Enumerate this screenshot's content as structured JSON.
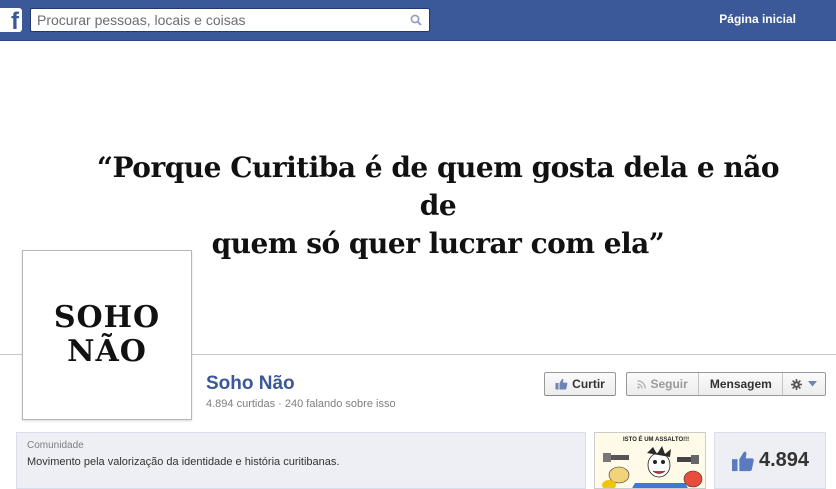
{
  "topbar": {
    "logo_letter": "f",
    "search_placeholder": "Procurar pessoas, locais e coisas",
    "home_label": "Página inicial"
  },
  "cover": {
    "quote_line1": "“Porque Curitiba é de quem gosta dela e não de",
    "quote_line2": "quem só quer lucrar com ela”"
  },
  "profile": {
    "pic_line1": "SOHO",
    "pic_line2": "NÃO",
    "name": "Soho Não",
    "stats": "4.894 curtidas · 240 falando sobre isso"
  },
  "actions": {
    "like_label": "Curtir",
    "follow_label": "Seguir",
    "message_label": "Mensagem"
  },
  "about": {
    "category": "Comunidade",
    "description": "Movimento pela valorização da identidade e história curitibanas."
  },
  "photo": {
    "caption": "ISTO É UM ASSALTO!!!"
  },
  "likes_box": {
    "count": "4.894"
  },
  "colors": {
    "brand": "#3b5998",
    "topbar_border": "#29447e"
  },
  "icons": [
    "facebook-logo",
    "search-icon",
    "thumbs-up-icon",
    "rss-icon",
    "gear-icon",
    "chevron-down-icon"
  ]
}
